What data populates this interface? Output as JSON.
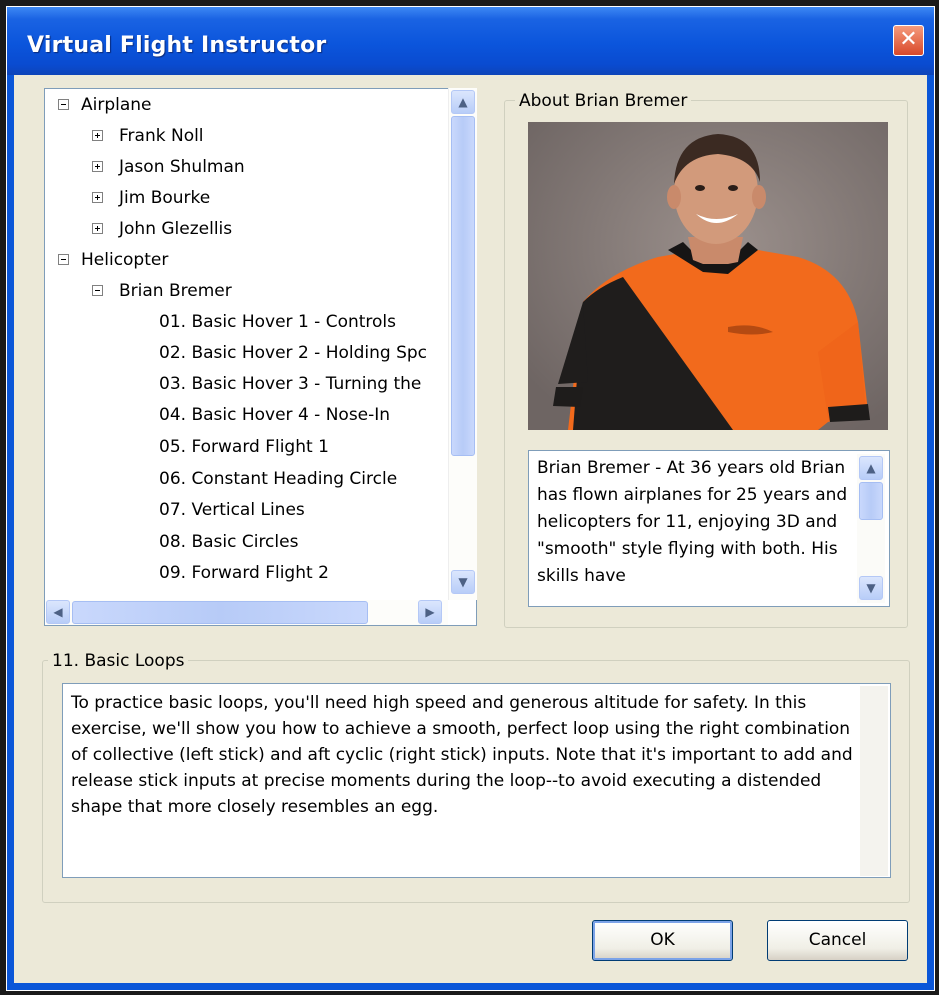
{
  "window": {
    "title": "Virtual Flight Instructor",
    "close_glyph": "✕"
  },
  "tree": {
    "airplane": {
      "label": "Airplane",
      "children": [
        "Frank Noll",
        "Jason Shulman",
        "Jim Bourke",
        "John Glezellis"
      ]
    },
    "helicopter": {
      "label": "Helicopter",
      "instructor": "Brian Bremer",
      "lessons": [
        "01. Basic Hover 1 - Controls",
        "02. Basic Hover 2 - Holding Spc",
        "03. Basic Hover 3 - Turning the",
        "04. Basic Hover 4 - Nose-In",
        "05. Forward Flight 1",
        "06. Constant Heading Circle",
        "07. Vertical Lines",
        "08. Basic Circles",
        "09. Forward Flight 2"
      ]
    }
  },
  "about": {
    "legend": "About Brian Bremer",
    "bio": "Brian Bremer - At 36 years old Brian has flown airplanes for 25 years and helicopters for 11, enjoying 3D and \"smooth\" style flying with both. His skills have"
  },
  "lesson": {
    "legend": "11. Basic Loops",
    "description": "To practice basic loops, you'll need high speed and generous altitude for safety. In this exercise, we'll show you how to achieve a smooth, perfect loop using the right combination of collective (left stick) and aft cyclic (right stick) inputs. Note that it's important to add and release stick inputs at precise moments during the loop--to avoid executing a distended shape that more closely resembles an egg."
  },
  "buttons": {
    "ok": "OK",
    "cancel": "Cancel"
  },
  "colors": {
    "titlebar": "#0a4bd0",
    "dialog_bg": "#ece9d8",
    "close": "#d9492a"
  },
  "icons": {
    "expanded": "minus-box-icon",
    "collapsed": "plus-box-icon",
    "scroll_up": "chevron-up-icon",
    "scroll_down": "chevron-down-icon",
    "scroll_left": "chevron-left-icon",
    "scroll_right": "chevron-right-icon"
  }
}
